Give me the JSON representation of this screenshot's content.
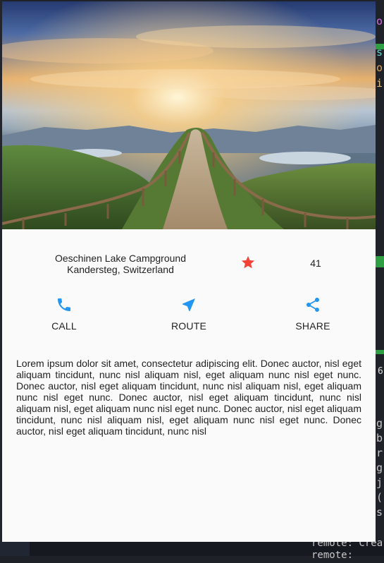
{
  "editor": {
    "snippets": [
      "o",
      "s",
      "o",
      "i",
      "6",
      "g",
      "b",
      "r",
      "g",
      "j",
      "(",
      "s"
    ],
    "terminal_text": "remote: Crea",
    "terminal_text2": "remote:"
  },
  "place": {
    "name": "Oeschinen Lake Campground",
    "location": "Kandersteg, Switzerland",
    "favorite_count": "41"
  },
  "actions": [
    {
      "label": "CALL",
      "icon": "phone-icon"
    },
    {
      "label": "ROUTE",
      "icon": "near-me-icon"
    },
    {
      "label": "SHARE",
      "icon": "share-icon"
    }
  ],
  "description": "Lorem ipsum dolor sit amet, consectetur adipiscing elit. Donec auctor, nisl eget aliquam tincidunt, nunc nisl aliquam nisl, eget aliquam nunc nisl eget nunc. Donec auctor, nisl eget aliquam tincidunt, nunc nisl aliquam nisl, eget aliquam nunc nisl eget nunc. Donec auctor, nisl eget aliquam tincidunt, nunc nisl aliquam nisl, eget aliquam nunc nisl eget nunc. Donec auctor, nisl eget aliquam tincidunt, nunc nisl aliquam nisl, eget aliquam nunc nisl eget nunc. Donec auctor, nisl eget aliquam tincidunt, nunc nisl",
  "colors": {
    "accent": "#2196f3",
    "star": "#f44336"
  }
}
